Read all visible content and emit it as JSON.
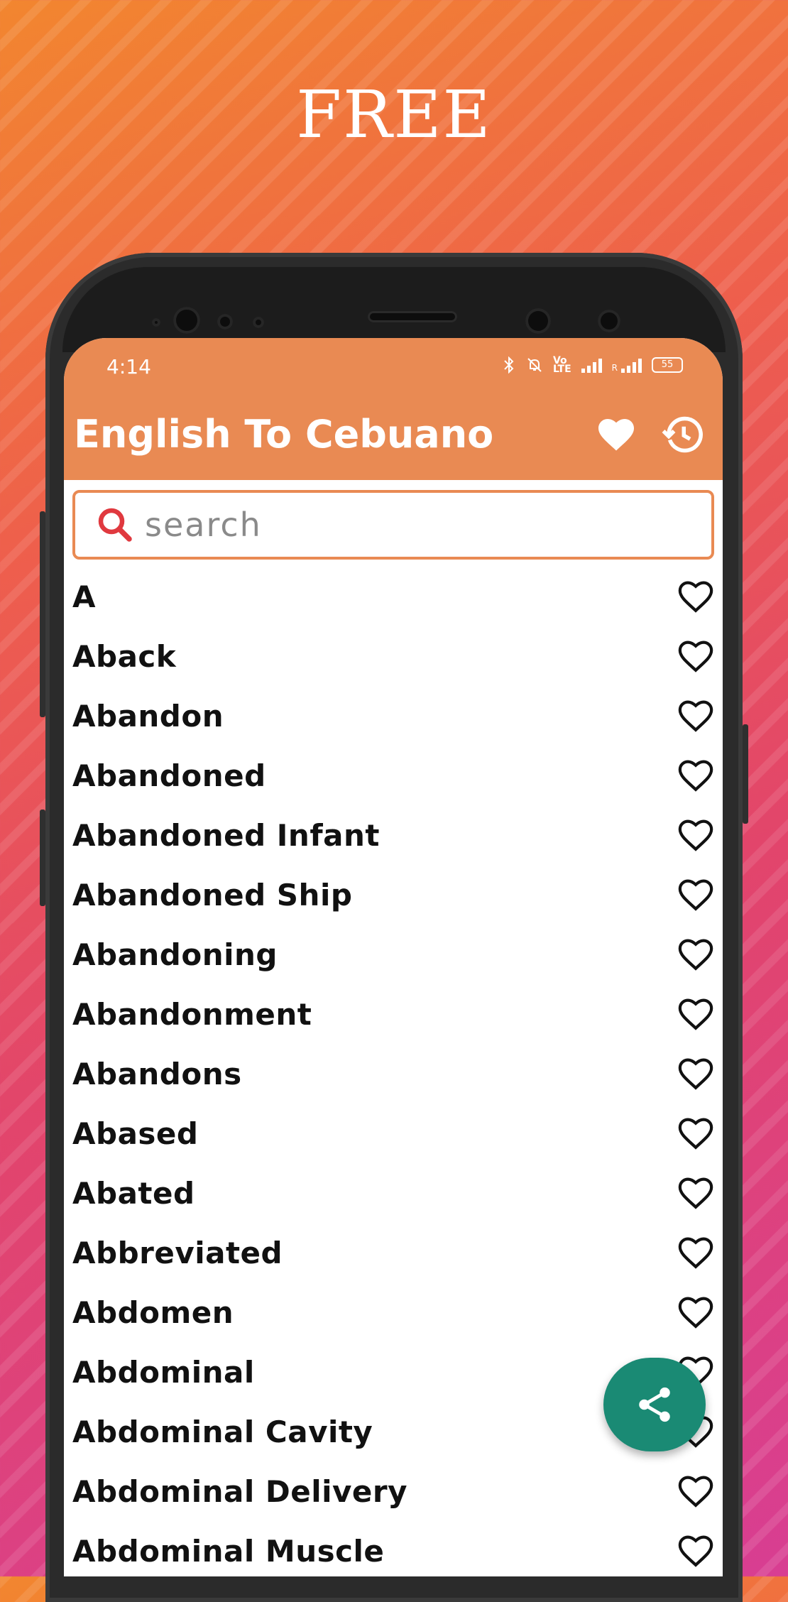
{
  "promo": {
    "title": "FREE"
  },
  "status_bar": {
    "time": "4:14",
    "battery": "55"
  },
  "app_bar": {
    "title": "English To Cebuano",
    "favorites_icon": "heart-icon",
    "history_icon": "history-icon"
  },
  "search": {
    "placeholder": "search",
    "value": ""
  },
  "words": [
    "A",
    "Aback",
    "Abandon",
    "Abandoned",
    "Abandoned Infant",
    "Abandoned Ship",
    "Abandoning",
    "Abandonment",
    "Abandons",
    "Abased",
    "Abated",
    "Abbreviated",
    "Abdomen",
    "Abdominal",
    "Abdominal Cavity",
    "Abdominal Delivery",
    "Abdominal Muscle"
  ],
  "fab": {
    "icon": "share-icon"
  },
  "colors": {
    "accent": "#e98a53",
    "fab": "#1a8a74",
    "search_icon": "#e0393f"
  }
}
